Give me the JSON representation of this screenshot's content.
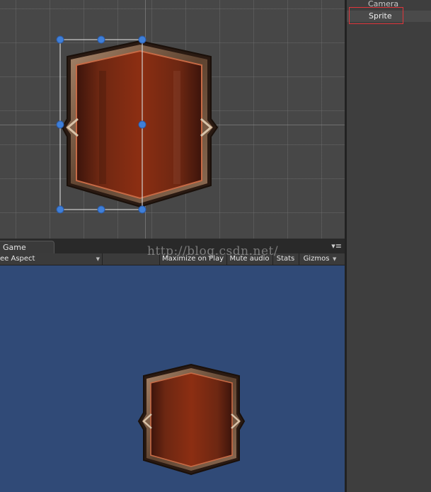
{
  "hierarchy": {
    "items": [
      {
        "label": "Camera",
        "selected": false
      },
      {
        "label": "Sprite",
        "selected": true
      }
    ],
    "highlight_color": "#e0353b"
  },
  "game_panel": {
    "tab_label": "Game",
    "aspect_label": "ee Aspect",
    "maximize_label": "Maximize on Play",
    "mute_label": "Mute audio",
    "stats_label": "Stats",
    "gizmos_label": "Gizmos",
    "background_color": "#304a77"
  },
  "watermark": "http://blog.csdn.net/",
  "icons": {
    "rect-handle": "blue circle",
    "panel-menu": "caret + bars",
    "dropdown-caret": "▾"
  }
}
